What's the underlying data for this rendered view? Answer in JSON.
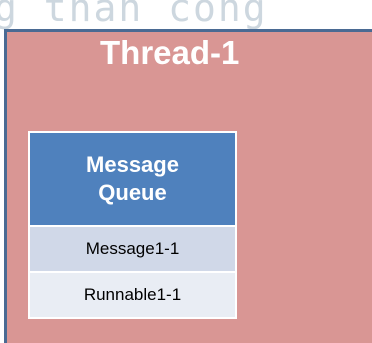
{
  "watermark": "g than cong",
  "thread": {
    "title": "Thread-1"
  },
  "message_queue": {
    "title_line1": "Message",
    "title_line2": "Queue",
    "items": [
      {
        "label": "Message1-1"
      },
      {
        "label": "Runnable1-1"
      }
    ]
  },
  "colors": {
    "thread_fill": "#d99694",
    "thread_border": "#4a6a93",
    "queue_header": "#4f81bd",
    "row_light": "#d0d8e8",
    "row_lighter": "#e9edf4"
  }
}
